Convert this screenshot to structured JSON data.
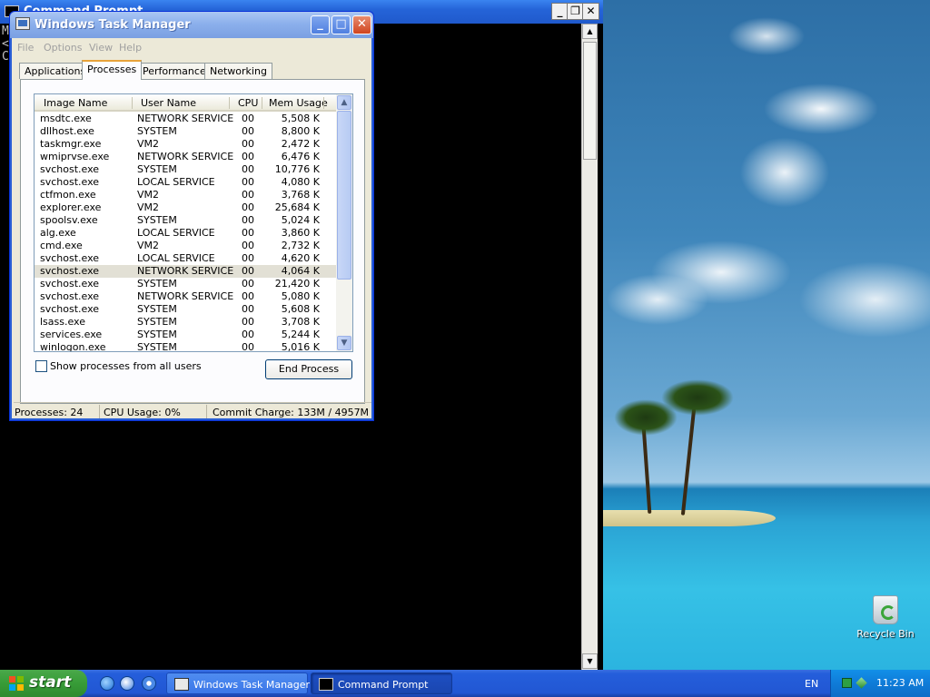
{
  "cmd": {
    "title": "Command Prompt",
    "lines": [
      "M",
      "<",
      "",
      "C"
    ]
  },
  "taskmgr": {
    "title": "Windows Task Manager",
    "menu": [
      "File",
      "Options",
      "View",
      "Help"
    ],
    "tabs": [
      "Applications",
      "Processes",
      "Performance",
      "Networking"
    ],
    "active_tab": "Processes",
    "columns": [
      "Image Name",
      "User Name",
      "CPU",
      "Mem Usage"
    ],
    "processes": [
      {
        "name": "msdtc.exe",
        "user": "NETWORK SERVICE",
        "cpu": "00",
        "mem": "5,508 K"
      },
      {
        "name": "dllhost.exe",
        "user": "SYSTEM",
        "cpu": "00",
        "mem": "8,800 K"
      },
      {
        "name": "taskmgr.exe",
        "user": "VM2",
        "cpu": "00",
        "mem": "2,472 K"
      },
      {
        "name": "wmiprvse.exe",
        "user": "NETWORK SERVICE",
        "cpu": "00",
        "mem": "6,476 K"
      },
      {
        "name": "svchost.exe",
        "user": "SYSTEM",
        "cpu": "00",
        "mem": "10,776 K"
      },
      {
        "name": "svchost.exe",
        "user": "LOCAL SERVICE",
        "cpu": "00",
        "mem": "4,080 K"
      },
      {
        "name": "ctfmon.exe",
        "user": "VM2",
        "cpu": "00",
        "mem": "3,768 K"
      },
      {
        "name": "explorer.exe",
        "user": "VM2",
        "cpu": "00",
        "mem": "25,684 K"
      },
      {
        "name": "spoolsv.exe",
        "user": "SYSTEM",
        "cpu": "00",
        "mem": "5,024 K"
      },
      {
        "name": "alg.exe",
        "user": "LOCAL SERVICE",
        "cpu": "00",
        "mem": "3,860 K"
      },
      {
        "name": "cmd.exe",
        "user": "VM2",
        "cpu": "00",
        "mem": "2,732 K"
      },
      {
        "name": "svchost.exe",
        "user": "LOCAL SERVICE",
        "cpu": "00",
        "mem": "4,620 K"
      },
      {
        "name": "svchost.exe",
        "user": "NETWORK SERVICE",
        "cpu": "00",
        "mem": "4,064 K",
        "selected": true
      },
      {
        "name": "svchost.exe",
        "user": "SYSTEM",
        "cpu": "00",
        "mem": "21,420 K"
      },
      {
        "name": "svchost.exe",
        "user": "NETWORK SERVICE",
        "cpu": "00",
        "mem": "5,080 K"
      },
      {
        "name": "svchost.exe",
        "user": "SYSTEM",
        "cpu": "00",
        "mem": "5,608 K"
      },
      {
        "name": "lsass.exe",
        "user": "SYSTEM",
        "cpu": "00",
        "mem": "3,708 K"
      },
      {
        "name": "services.exe",
        "user": "SYSTEM",
        "cpu": "00",
        "mem": "5,244 K"
      },
      {
        "name": "winlogon.exe",
        "user": "SYSTEM",
        "cpu": "00",
        "mem": "5,016 K"
      }
    ],
    "show_all_label": "Show processes from all users",
    "show_all_checked": false,
    "end_process_label": "End Process",
    "status": {
      "processes": "Processes: 24",
      "cpu": "CPU Usage: 0%",
      "commit": "Commit Charge: 133M / 4957M"
    }
  },
  "desktop": {
    "recycle_bin_label": "Recycle Bin"
  },
  "taskbar": {
    "start_label": "start",
    "quick_launch": [
      "ie-icon",
      "media-player-icon",
      "show-desktop-icon"
    ],
    "tasks": [
      {
        "label": "Windows Task Manager",
        "active": false
      },
      {
        "label": "Command Prompt",
        "active": true
      }
    ],
    "language": "EN",
    "clock": "11:23 AM"
  },
  "colors": {
    "xp_blue": "#245edb",
    "start_green": "#379c37",
    "tray_blue": "#0f7bd8",
    "tab_highlight": "#e8a33a"
  }
}
